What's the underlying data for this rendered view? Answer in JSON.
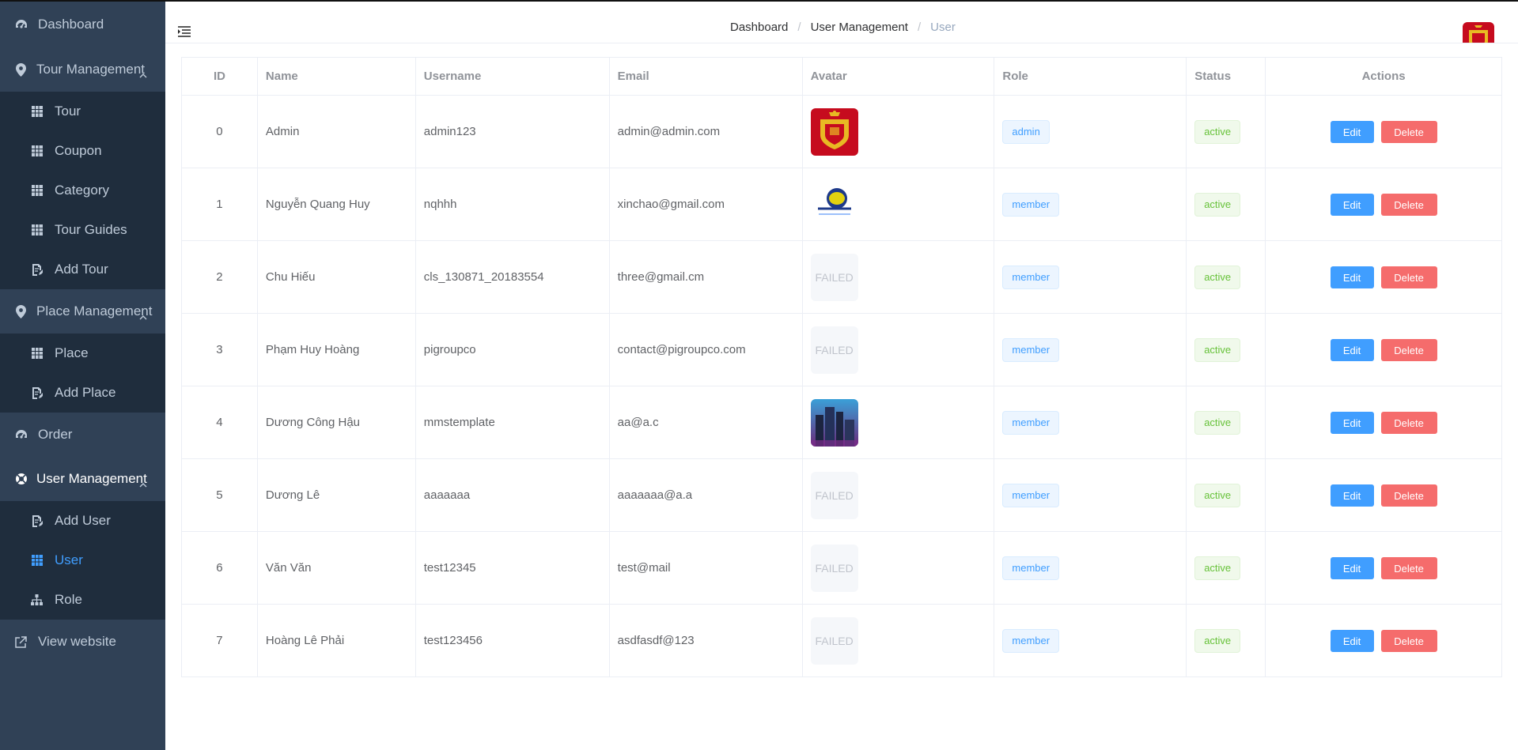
{
  "sidebar": {
    "dashboard": "Dashboard",
    "tour_management": "Tour Management",
    "tour_items": [
      "Tour",
      "Coupon",
      "Category",
      "Tour Guides",
      "Add Tour"
    ],
    "place_management": "Place Management",
    "place_items": [
      "Place",
      "Add Place"
    ],
    "order": "Order",
    "user_management": "User Management",
    "user_items": [
      "Add User",
      "User",
      "Role"
    ],
    "active_item": "User",
    "view_website": "View website"
  },
  "breadcrumb": [
    "Dashboard",
    "User Management",
    "User"
  ],
  "table": {
    "headers": [
      "ID",
      "Name",
      "Username",
      "Email",
      "Avatar",
      "Role",
      "Status",
      "Actions"
    ],
    "rows": [
      {
        "id": "0",
        "name": "Admin",
        "username": "admin123",
        "email": "admin@admin.com",
        "avatar": "spain-crest",
        "role": "admin",
        "status": "active"
      },
      {
        "id": "1",
        "name": "Nguyễn Quang Huy",
        "username": "nqhhh",
        "email": "xinchao@gmail.com",
        "avatar": "de-manejar-logo",
        "role": "member",
        "status": "active"
      },
      {
        "id": "2",
        "name": "Chu Hiếu",
        "username": "cls_130871_20183554",
        "email": "three@gmail.cm",
        "avatar": "FAILED",
        "role": "member",
        "status": "active"
      },
      {
        "id": "3",
        "name": "Phạm Huy Hoàng",
        "username": "pigroupco",
        "email": "contact@pigroupco.com",
        "avatar": "FAILED",
        "role": "member",
        "status": "active"
      },
      {
        "id": "4",
        "name": "Dương Công Hậu",
        "username": "mmstemplate",
        "email": "aa@a.c",
        "avatar": "city-night-photo",
        "role": "member",
        "status": "active"
      },
      {
        "id": "5",
        "name": "Dương Lê",
        "username": "aaaaaaa",
        "email": "aaaaaaa@a.a",
        "avatar": "FAILED",
        "role": "member",
        "status": "active"
      },
      {
        "id": "6",
        "name": "Văn Văn",
        "username": "test12345",
        "email": "test@mail",
        "avatar": "FAILED",
        "role": "member",
        "status": "active"
      },
      {
        "id": "7",
        "name": "Hoàng Lê Phải",
        "username": "test123456",
        "email": "asdfasdf@123",
        "avatar": "FAILED",
        "role": "member",
        "status": "active"
      }
    ],
    "edit_label": "Edit",
    "delete_label": "Delete"
  },
  "colors": {
    "sidebar_bg": "#304156",
    "submenu_bg": "#1f2d3d",
    "accent": "#409eff",
    "danger": "#f56c6c",
    "success": "#67c23a"
  },
  "icons": {
    "dashboard": "dashboard-gauge-icon",
    "group": "map-pin-icon",
    "table": "table-grid-icon",
    "add": "document-edit-icon",
    "user_group": "life-ring-icon",
    "role": "sitemap-icon",
    "external": "external-link-icon",
    "hamburger": "menu-fold-icon"
  }
}
